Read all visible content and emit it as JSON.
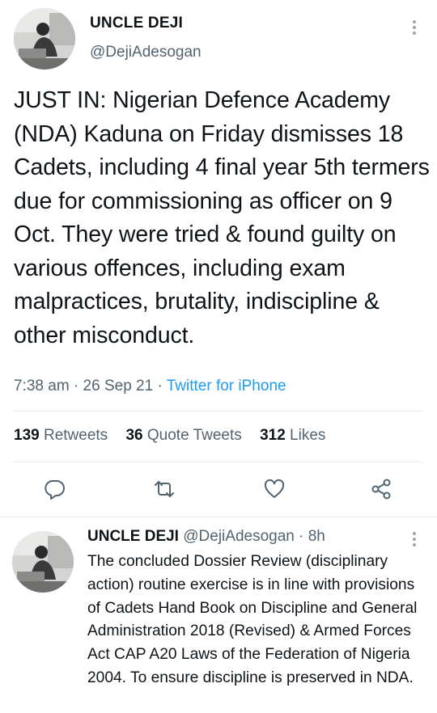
{
  "main_tweet": {
    "author_name": "UNCLE DEJI",
    "author_handle": "@DejiAdesogan",
    "text": "JUST IN: Nigerian Defence Academy (NDA) Kaduna on Friday dismisses 18 Cadets, including 4 final year 5th termers due for commissioning as officer on 9 Oct. They were tried & found guilty on various offences, including exam malpractices, brutality, indiscipline & other misconduct.",
    "time": "7:38 am",
    "date": "26 Sep 21",
    "source": "Twitter for iPhone",
    "retweets_count": "139",
    "retweets_label": "Retweets",
    "quotes_count": "36",
    "quotes_label": "Quote Tweets",
    "likes_count": "312",
    "likes_label": "Likes"
  },
  "reply_tweet": {
    "author_name": "UNCLE DEJI",
    "author_handle": "@DejiAdesogan",
    "age": "8h",
    "text": "The concluded Dossier Review (disciplinary action) routine exercise is in line with provisions of Cadets Hand Book on Discipline and General Administration  2018 (Revised) & Armed Forces Act CAP A20 Laws of the Federation of Nigeria 2004. To ensure discipline is preserved in NDA."
  },
  "icons": {
    "reply": "reply-icon",
    "retweet": "retweet-icon",
    "like": "heart-icon",
    "share": "share-icon",
    "more": "more-vertical-icon"
  },
  "colors": {
    "accent": "#1d9bf0",
    "secondary_text": "#536471",
    "primary_text": "#0f1419",
    "divider": "#e6ecf0"
  }
}
